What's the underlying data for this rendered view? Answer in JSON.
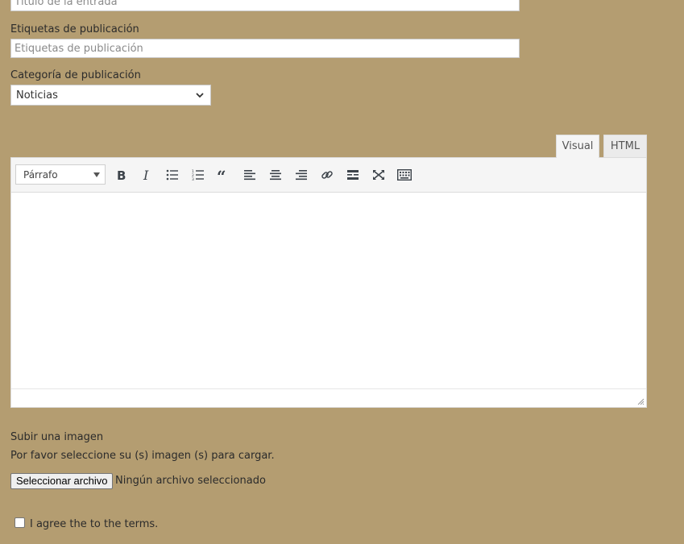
{
  "title_field": {
    "placeholder": "Título de la entrada"
  },
  "tags_field": {
    "label": "Etiquetas de publicación",
    "placeholder": "Etiquetas de publicación"
  },
  "category": {
    "label": "Categoría de publicación",
    "selected": "Noticias"
  },
  "editor": {
    "tabs": {
      "visual": "Visual",
      "html": "HTML"
    },
    "format_selected": "Párrafo",
    "toolbar_icons": [
      "bold-icon",
      "italic-icon",
      "bullet-list-icon",
      "numbered-list-icon",
      "blockquote-icon",
      "align-left-icon",
      "align-center-icon",
      "align-right-icon",
      "link-icon",
      "read-more-icon",
      "fullscreen-icon",
      "toolbar-toggle-icon"
    ]
  },
  "upload": {
    "heading": "Subir una imagen",
    "instructions": "Por favor seleccione su (s) imagen (s) para cargar.",
    "button_label": "Seleccionar archivo",
    "status": "Ningún archivo seleccionado"
  },
  "terms": {
    "label": "I agree the to the terms."
  }
}
